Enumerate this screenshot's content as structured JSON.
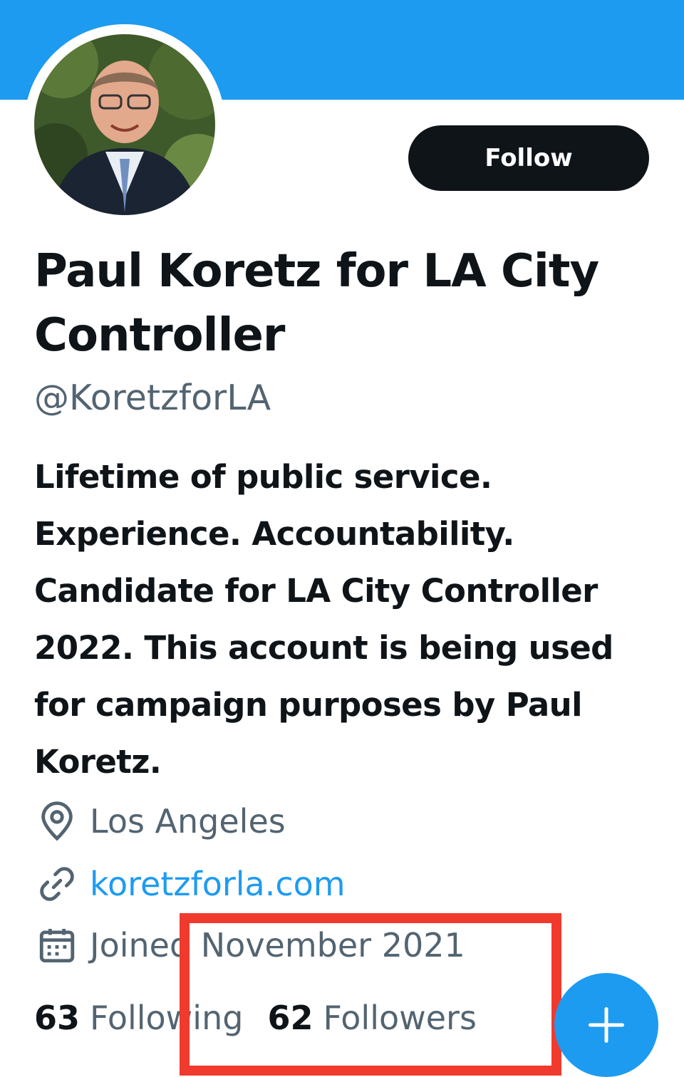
{
  "profile": {
    "avatar_alt": "profile photo",
    "follow_label": "Follow",
    "name": "Paul Koretz for LA City Controller",
    "handle": "@KoretzforLA",
    "bio": "Lifetime of public service. Experience. Accountability. Candidate for LA City Controller 2022. This account is being used for campaign purposes by Paul Koretz.",
    "location": "Los Angeles",
    "website": "koretzforla.com",
    "joined": "Joined November 2021",
    "following_count": "63",
    "following_label": "Following",
    "followers_count": "62",
    "followers_label": "Followers"
  },
  "icons": {
    "location": "location-pin-icon",
    "link": "link-icon",
    "calendar": "calendar-icon",
    "compose": "plus-icon"
  },
  "colors": {
    "banner": "#1d9bf0",
    "accent": "#1d9bf0",
    "follow_button": "#0f1419",
    "secondary_text": "#536471",
    "highlight_box": "#f03a2e"
  }
}
